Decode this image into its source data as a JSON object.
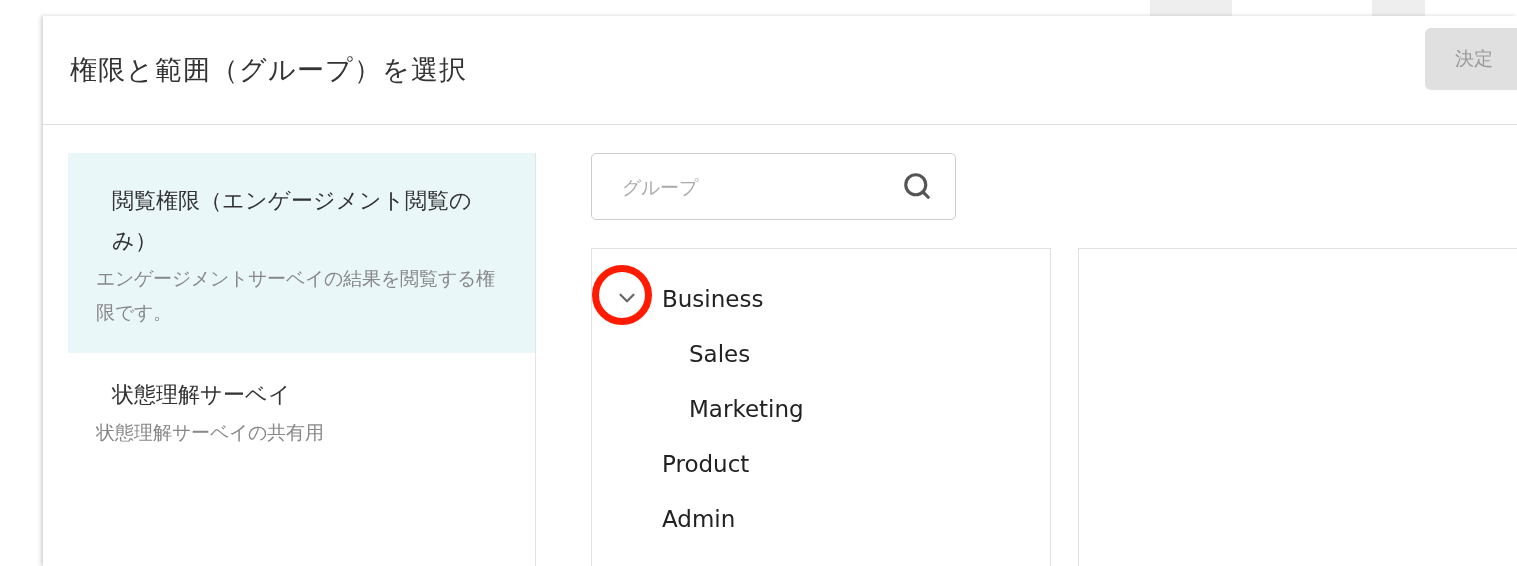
{
  "dialog": {
    "title": "権限と範囲（グループ）を選択",
    "confirm_button": {
      "label": "決定",
      "disabled": true
    }
  },
  "roles": [
    {
      "name": "閲覧権限（エンゲージメント閲覧のみ）",
      "description": "エンゲージメントサーベイの結果を閲覧する権限です。",
      "selected": true
    },
    {
      "name": "状態理解サーベイ",
      "description": "状態理解サーベイの共有用",
      "selected": false
    }
  ],
  "search": {
    "placeholder": "グループ"
  },
  "tree": [
    {
      "label": "Business",
      "expanded": true,
      "marked": true,
      "children": [
        {
          "label": "Sales"
        },
        {
          "label": "Marketing"
        }
      ]
    },
    {
      "label": "Product"
    },
    {
      "label": "Admin"
    }
  ]
}
